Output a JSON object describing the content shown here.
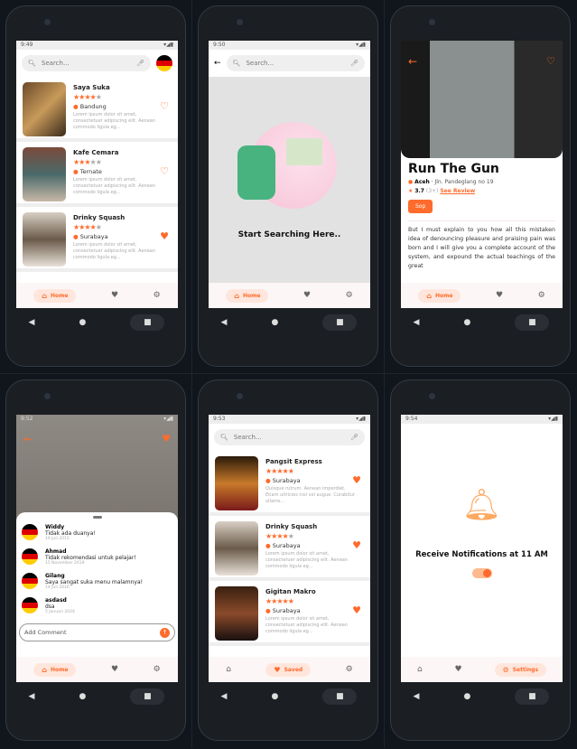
{
  "accent": "#ff6b2c",
  "search_placeholder": "Search...",
  "nav": {
    "home": "Home",
    "saved": "Saved",
    "settings": "Settings"
  },
  "screen1": {
    "time": "9:49",
    "items": [
      {
        "name": "Saya Suka",
        "rating": 4.5,
        "city": "Bandung",
        "desc": "Lorem ipsum dolor sit amet, consectetuer adipiscing elit. Aenean commodo ligula eg...",
        "saved": false
      },
      {
        "name": "Kafe Cemara",
        "rating": 3.5,
        "city": "Ternate",
        "desc": "Lorem ipsum dolor sit amet, consectetuer adipiscing elit. Aenean commodo ligula eg...",
        "saved": false
      },
      {
        "name": "Drinky Squash",
        "rating": 4,
        "city": "Surabaya",
        "desc": "Lorem ipsum dolor sit amet, consectetuer adipiscing elit. Aenean commodo ligula eg...",
        "saved": true
      }
    ]
  },
  "screen2": {
    "time": "9:50",
    "message": "Start Searching Here.."
  },
  "screen3": {
    "title": "Run The Gun",
    "city": "Aceh",
    "address": "Jln. Pandeglang no 19",
    "rating": "3.7",
    "reviews": "(3+)",
    "see_review": "See Review",
    "button": "Sop",
    "body": "But I must explain to you how all this mistaken idea of denouncing pleasure and praising pain was born and I will give you a complete account of the system, and expound the actual teachings of the great"
  },
  "screen4": {
    "time": "9:52",
    "comments": [
      {
        "user": "Widdy",
        "text": "Tidak ada duanya!",
        "date": "19 Juli 2015"
      },
      {
        "user": "Ahmad",
        "text": "Tidak rekomendasi untuk pelajar!",
        "date": "15 November 2019"
      },
      {
        "user": "Gilang",
        "text": "Saya sangat suka menu malamnya!",
        "date": "14 Juli 2016"
      },
      {
        "user": "asdasd",
        "text": "dsa",
        "date": "5 Januari 2024"
      }
    ],
    "add_placeholder": "Add Comment"
  },
  "screen5": {
    "time": "9:53",
    "items": [
      {
        "name": "Pangsit Express",
        "rating": 5,
        "city": "Surabaya",
        "desc": "Quisque rutrum. Aenean imperdiet. Etiam ultricies nisi vel augue. Curabitur ullams..."
      },
      {
        "name": "Drinky Squash",
        "rating": 4,
        "city": "Surabaya",
        "desc": "Lorem ipsum dolor sit amet, consectetuer adipiscing elit. Aenean commodo ligula eg..."
      },
      {
        "name": "Gigitan Makro",
        "rating": 5,
        "city": "Surabaya",
        "desc": "Lorem ipsum dolor sit amet, consectetuer adipiscing elit. Aenean commodo ligula eg..."
      }
    ]
  },
  "screen6": {
    "time": "9:54",
    "message": "Receive Notifications at 11 AM",
    "toggle_on": true
  }
}
